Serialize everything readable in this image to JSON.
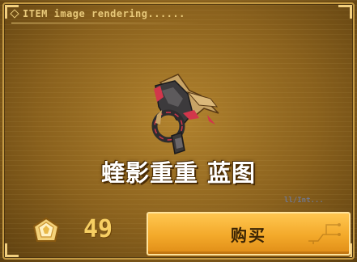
{
  "header": {
    "text": "ITEM image rendering......"
  },
  "item": {
    "name": "蝰影重重 蓝图",
    "icon": "weapon-blueprint-icon"
  },
  "decor": {
    "text": "ll/Int..."
  },
  "purchase": {
    "currency_icon": "gem-currency-icon",
    "price": "49",
    "buy_label": "购买"
  },
  "colors": {
    "accent": "#f3a92a",
    "panel": "#8a611d",
    "price": "#f7cf63",
    "text": "#ffffff"
  }
}
